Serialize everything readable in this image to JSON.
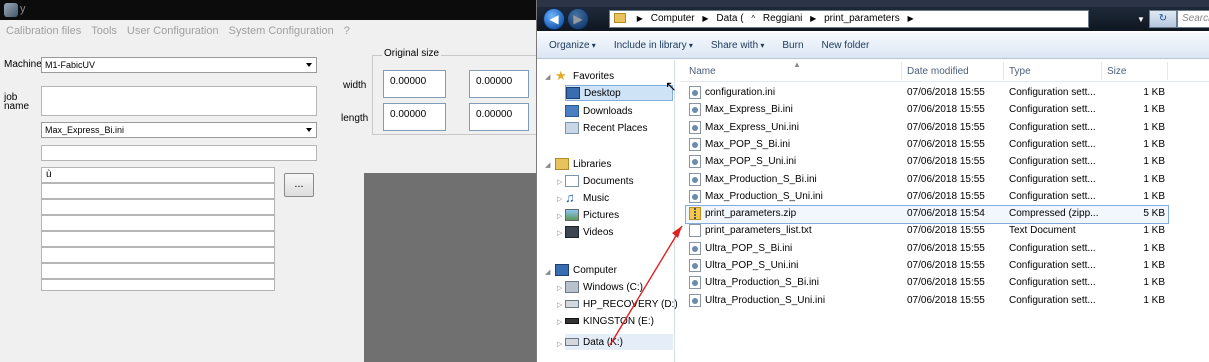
{
  "left_app": {
    "title": "y",
    "menu": [
      "Calibration files",
      "Tools",
      "User Configuration",
      "System Configuration",
      "?"
    ],
    "machine_label": "Machine",
    "machine_value": "M1-FabicUV",
    "job_name_label_1": "job",
    "job_name_label_2": "name",
    "profile_value": "Max_Express_Bi.ini",
    "field_char": "ù",
    "dots_button": "...",
    "original_size_label": "Original size",
    "width_label": "width",
    "length_label": "length",
    "width_values": [
      "0.00000",
      "0.00000"
    ],
    "length_values": [
      "0.00000",
      "0.00000"
    ]
  },
  "explorer": {
    "breadcrumb": [
      "Computer",
      "Data (",
      "Reggiani",
      "print_parameters"
    ],
    "search_placeholder": "Search",
    "commands": [
      "Organize",
      "Include in library",
      "Share with",
      "Burn",
      "New folder"
    ],
    "nav": {
      "favorites": "Favorites",
      "desktop": "Desktop",
      "downloads": "Downloads",
      "recent": "Recent Places",
      "libraries": "Libraries",
      "documents": "Documents",
      "music": "Music",
      "pictures": "Pictures",
      "videos": "Videos",
      "computer": "Computer",
      "drive_c": "Windows (C:)",
      "drive_d": "HP_RECOVERY (D:)",
      "drive_e": "KINGSTON (E:)",
      "drive_k": "Data (K:)"
    },
    "columns": {
      "name": "Name",
      "date": "Date modified",
      "type": "Type",
      "size": "Size"
    },
    "files": [
      {
        "name": "configuration.ini",
        "date": "07/06/2018 15:55",
        "type": "Configuration sett...",
        "size": "1 KB",
        "icon": "ini"
      },
      {
        "name": "Max_Express_Bi.ini",
        "date": "07/06/2018 15:55",
        "type": "Configuration sett...",
        "size": "1 KB",
        "icon": "ini"
      },
      {
        "name": "Max_Express_Uni.ini",
        "date": "07/06/2018 15:55",
        "type": "Configuration sett...",
        "size": "1 KB",
        "icon": "ini"
      },
      {
        "name": "Max_POP_S_Bi.ini",
        "date": "07/06/2018 15:55",
        "type": "Configuration sett...",
        "size": "1 KB",
        "icon": "ini"
      },
      {
        "name": "Max_POP_S_Uni.ini",
        "date": "07/06/2018 15:55",
        "type": "Configuration sett...",
        "size": "1 KB",
        "icon": "ini"
      },
      {
        "name": "Max_Production_S_Bi.ini",
        "date": "07/06/2018 15:55",
        "type": "Configuration sett...",
        "size": "1 KB",
        "icon": "ini"
      },
      {
        "name": "Max_Production_S_Uni.ini",
        "date": "07/06/2018 15:55",
        "type": "Configuration sett...",
        "size": "1 KB",
        "icon": "ini"
      },
      {
        "name": "print_parameters.zip",
        "date": "07/06/2018 15:54",
        "type": "Compressed (zipp...",
        "size": "5 KB",
        "icon": "zip"
      },
      {
        "name": "print_parameters_list.txt",
        "date": "07/06/2018 15:55",
        "type": "Text Document",
        "size": "1 KB",
        "icon": "txt"
      },
      {
        "name": "Ultra_POP_S_Bi.ini",
        "date": "07/06/2018 15:55",
        "type": "Configuration sett...",
        "size": "1 KB",
        "icon": "ini"
      },
      {
        "name": "Ultra_POP_S_Uni.ini",
        "date": "07/06/2018 15:55",
        "type": "Configuration sett...",
        "size": "1 KB",
        "icon": "ini"
      },
      {
        "name": "Ultra_Production_S_Bi.ini",
        "date": "07/06/2018 15:55",
        "type": "Configuration sett...",
        "size": "1 KB",
        "icon": "ini"
      },
      {
        "name": "Ultra_Production_S_Uni.ini",
        "date": "07/06/2018 15:55",
        "type": "Configuration sett...",
        "size": "1 KB",
        "icon": "ini"
      }
    ],
    "selected_index": 7
  },
  "colors": {
    "annotation_arrow": "#e02020",
    "selection_border": "#84acdd"
  }
}
